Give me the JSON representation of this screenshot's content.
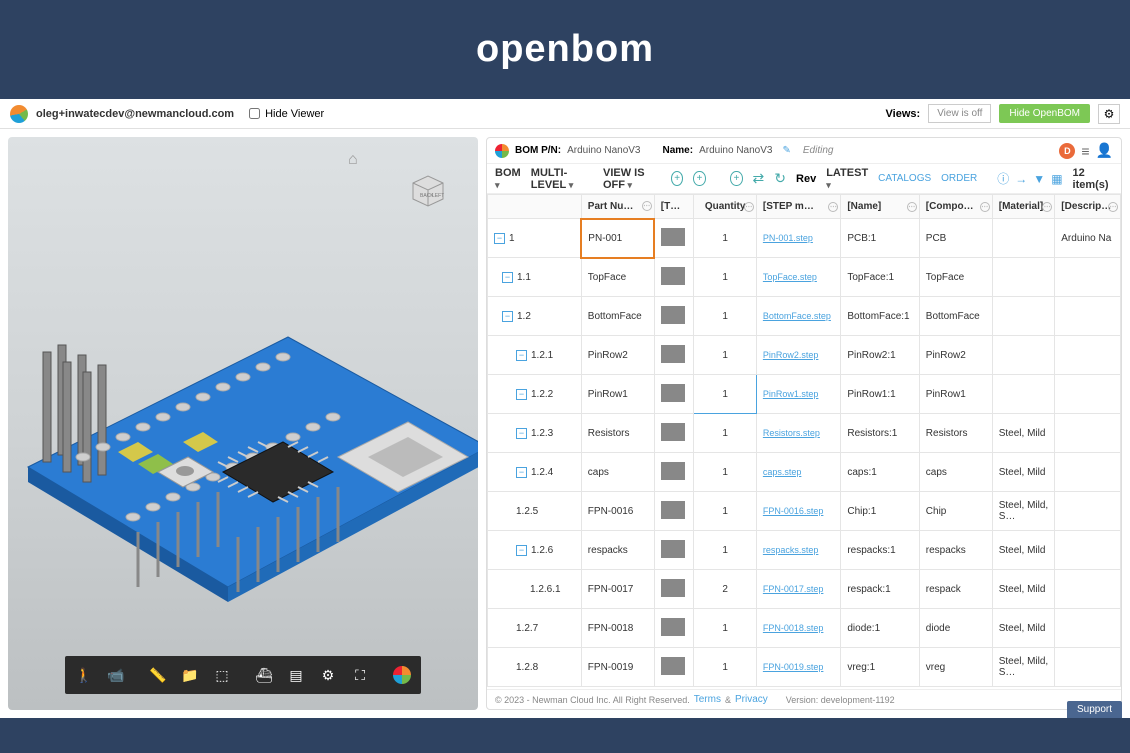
{
  "brand": "openbom",
  "topbar": {
    "user_email": "oleg+inwatecdev@newmancloud.com",
    "hide_viewer": "Hide Viewer",
    "views_label": "Views:",
    "views_value": "View is off",
    "hide_openbom": "Hide OpenBOM"
  },
  "bom_header": {
    "pn_label": "BOM P/N:",
    "pn_value": "Arduino NanoV3",
    "name_label": "Name:",
    "name_value": "Arduino NanoV3",
    "editing": "Editing",
    "avatar_letter": "D"
  },
  "toolbar": {
    "bom": "BOM",
    "multi_level": "MULTI-LEVEL",
    "view_is_off": "VIEW IS OFF",
    "rev": "Rev",
    "latest": "LATEST",
    "catalogs": "CATALOGS",
    "order": "ORDER",
    "items": "12 item(s)"
  },
  "columns": [
    "",
    "Part Nu…",
    "[T…",
    "Quantity",
    "[STEP m…",
    "[Name]",
    "[Compo…",
    "[Material]",
    "[Descrip…"
  ],
  "rows": [
    {
      "ind": 0,
      "tog": true,
      "num": "1",
      "pn": "PN-001",
      "pn_hl": true,
      "qty": "1",
      "step": "PN-001.step",
      "name": "PCB:1",
      "comp": "PCB",
      "mat": "",
      "desc": "Arduino Na"
    },
    {
      "ind": 1,
      "tog": true,
      "num": "1.1",
      "pn": "TopFace",
      "qty": "1",
      "step": "TopFace.step",
      "name": "TopFace:1",
      "comp": "TopFace",
      "mat": "",
      "desc": ""
    },
    {
      "ind": 1,
      "tog": true,
      "num": "1.2",
      "pn": "BottomFace",
      "qty": "1",
      "step": "BottomFace.step",
      "name": "BottomFace:1",
      "comp": "BottomFace",
      "mat": "",
      "desc": ""
    },
    {
      "ind": 2,
      "tog": true,
      "num": "1.2.1",
      "pn": "PinRow2",
      "qty": "1",
      "step": "PinRow2.step",
      "name": "PinRow2:1",
      "comp": "PinRow2",
      "mat": "",
      "desc": ""
    },
    {
      "ind": 2,
      "tog": true,
      "num": "1.2.2",
      "pn": "PinRow1",
      "qty": "1",
      "qty_hl": true,
      "step": "PinRow1.step",
      "name": "PinRow1:1",
      "comp": "PinRow1",
      "mat": "",
      "desc": ""
    },
    {
      "ind": 2,
      "tog": true,
      "num": "1.2.3",
      "pn": "Resistors",
      "qty": "1",
      "step": "Resistors.step",
      "name": "Resistors:1",
      "comp": "Resistors",
      "mat": "Steel, Mild",
      "desc": ""
    },
    {
      "ind": 2,
      "tog": true,
      "num": "1.2.4",
      "pn": "caps",
      "qty": "1",
      "step": "caps.step",
      "name": "caps:1",
      "comp": "caps",
      "mat": "Steel, Mild",
      "desc": ""
    },
    {
      "ind": 2,
      "tog": false,
      "num": "1.2.5",
      "pn": "FPN-0016",
      "qty": "1",
      "step": "FPN-0016.step",
      "name": "Chip:1",
      "comp": "Chip",
      "mat": "Steel, Mild, S…",
      "desc": ""
    },
    {
      "ind": 2,
      "tog": true,
      "num": "1.2.6",
      "pn": "respacks",
      "qty": "1",
      "step": "respacks.step",
      "name": "respacks:1",
      "comp": "respacks",
      "mat": "Steel, Mild",
      "desc": ""
    },
    {
      "ind": 3,
      "tog": false,
      "num": "1.2.6.1",
      "pn": "FPN-0017",
      "qty": "2",
      "step": "FPN-0017.step",
      "name": "respack:1",
      "comp": "respack",
      "mat": "Steel, Mild",
      "desc": ""
    },
    {
      "ind": 2,
      "tog": false,
      "num": "1.2.7",
      "pn": "FPN-0018",
      "qty": "1",
      "step": "FPN-0018.step",
      "name": "diode:1",
      "comp": "diode",
      "mat": "Steel, Mild",
      "desc": ""
    },
    {
      "ind": 2,
      "tog": false,
      "num": "1.2.8",
      "pn": "FPN-0019",
      "qty": "1",
      "step": "FPN-0019.step",
      "name": "vreg:1",
      "comp": "vreg",
      "mat": "Steel, Mild, S…",
      "desc": ""
    }
  ],
  "footer": {
    "copyright": "© 2023 - Newman Cloud Inc. All Right Reserved.",
    "terms": "Terms",
    "amp": "&",
    "privacy": "Privacy",
    "version": "Version: development-1192",
    "support": "Support"
  }
}
